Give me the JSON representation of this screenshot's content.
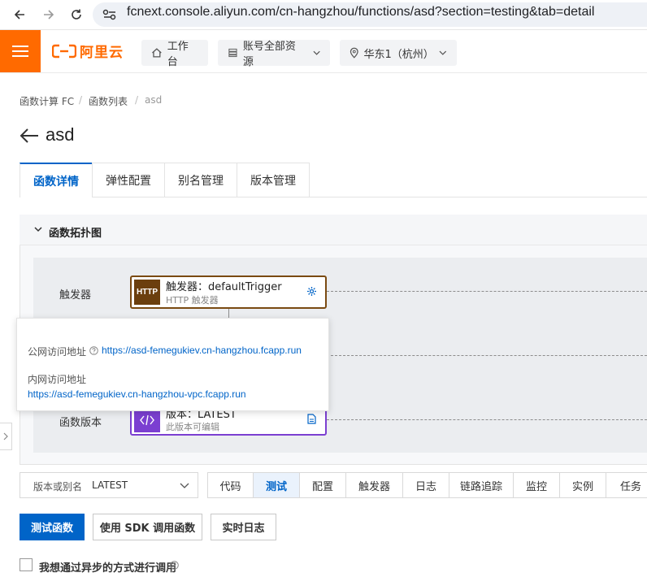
{
  "browser": {
    "url": "fcnext.console.aliyun.com/cn-hangzhou/functions/asd?section=testing&tab=detail"
  },
  "header": {
    "logo_text": "阿里云",
    "workbench": "工作台",
    "resources": "账号全部资源",
    "region": "华东1（杭州）"
  },
  "breadcrumb": [
    "函数计算 FC",
    "函数列表",
    "asd"
  ],
  "page_title": "asd",
  "tabs": [
    "函数详情",
    "弹性配置",
    "别名管理",
    "版本管理"
  ],
  "topology": {
    "title": "函数拓扑图",
    "trigger_row_label": "触发器",
    "trigger_name": "触发器：defaultTrigger",
    "trigger_type": "HTTP 触发器",
    "trigger_badge": "HTTP",
    "version_row_label": "函数版本",
    "version_name": "版本：LATEST",
    "version_desc": "此版本可编辑"
  },
  "popover": {
    "public_label": "公网访问地址",
    "public_url": "https://asd-femegukiev.cn-hangzhou.fcapp.run",
    "private_label": "内网访问地址",
    "private_url": "https://asd-femegukiev.cn-hangzhou-vpc.fcapp.run"
  },
  "version_select": {
    "label": "版本或别名",
    "value": "LATEST"
  },
  "sub_tabs": [
    "代码",
    "测试",
    "配置",
    "触发器",
    "日志",
    "链路追踪",
    "监控",
    "实例",
    "任务"
  ],
  "actions": {
    "test_function": "测试函数",
    "sdk_invoke": "使用 SDK 调用函数",
    "realtime_log": "实时日志"
  },
  "async_checkbox_label": "我想通过异步的方式进行调用",
  "colors": {
    "brand": "#ff6a00",
    "primary": "#0064c8",
    "trigger_border": "#7a4a12",
    "version_border": "#7b3fd1"
  }
}
